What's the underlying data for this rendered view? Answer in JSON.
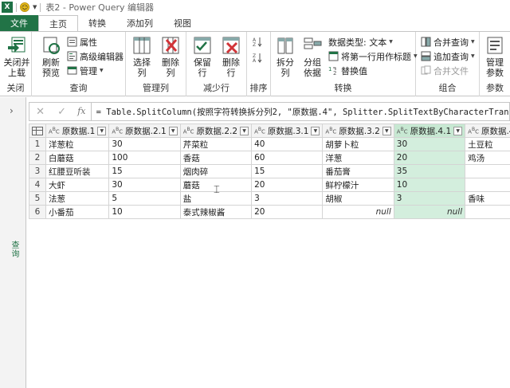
{
  "titlebar": {
    "app_icon": "excel-icon",
    "title": "表2 - Power Query 编辑器"
  },
  "tabs": [
    {
      "label": "文件"
    },
    {
      "label": "主页"
    },
    {
      "label": "转换"
    },
    {
      "label": "添加列"
    },
    {
      "label": "视图"
    }
  ],
  "ribbon": {
    "close": {
      "btn": "关闭并\n上载",
      "group": "关闭"
    },
    "query": {
      "refresh": "刷新\n预览",
      "properties": "属性",
      "advanced": "高级编辑器",
      "manage": "管理",
      "group": "查询"
    },
    "manage_cols": {
      "choose": "选择\n列",
      "remove": "删除\n列",
      "group": "管理列"
    },
    "reduce_rows": {
      "keep": "保留\n行",
      "remove": "删除\n行",
      "group": "减少行"
    },
    "sort": {
      "group": "排序"
    },
    "transform": {
      "split": "拆分\n列",
      "groupby": "分组\n依据",
      "datatype": "数据类型: 文本",
      "first_row": "将第一行用作标题",
      "replace": "替换值",
      "group": "转换"
    },
    "combine": {
      "merge": "合并查询",
      "append": "追加查询",
      "files": "合并文件",
      "group": "组合"
    },
    "params": {
      "manage": "管理\n参数",
      "group": "参数"
    }
  },
  "leftpane": {
    "label": "查询"
  },
  "formula": {
    "text": "= Table.SplitColumn(按照字符转换拆分列2, \"原数据.4\", Splitter.SplitTextByCharacterTransition({\""
  },
  "grid": {
    "columns": [
      {
        "name": "原数据.1"
      },
      {
        "name": "原数据.2.1"
      },
      {
        "name": "原数据.2.2"
      },
      {
        "name": "原数据.3.1"
      },
      {
        "name": "原数据.3.2"
      },
      {
        "name": "原数据.4.1"
      },
      {
        "name": "原数据.4"
      }
    ],
    "rows": [
      [
        "1",
        "洋葱粒",
        "30",
        "芹菜粒",
        "40",
        "胡萝卜粒",
        "30",
        "土豆粒"
      ],
      [
        "2",
        "白蘑菇",
        "100",
        "香菇",
        "60",
        "洋葱",
        "20",
        "鸡汤"
      ],
      [
        "3",
        "红腰豆听装",
        "15",
        "烟肉碎",
        "15",
        "番茄膏",
        "35",
        ""
      ],
      [
        "4",
        "大虾",
        "30",
        "蘑菇",
        "20",
        "鲜柠檬汁",
        "10",
        ""
      ],
      [
        "5",
        "法葱",
        "5",
        "盐",
        "3",
        "胡椒",
        "3",
        "香味"
      ],
      [
        "6",
        "小番茄",
        "10",
        "泰式辣椒酱",
        "20",
        "null",
        "null",
        ""
      ]
    ]
  }
}
